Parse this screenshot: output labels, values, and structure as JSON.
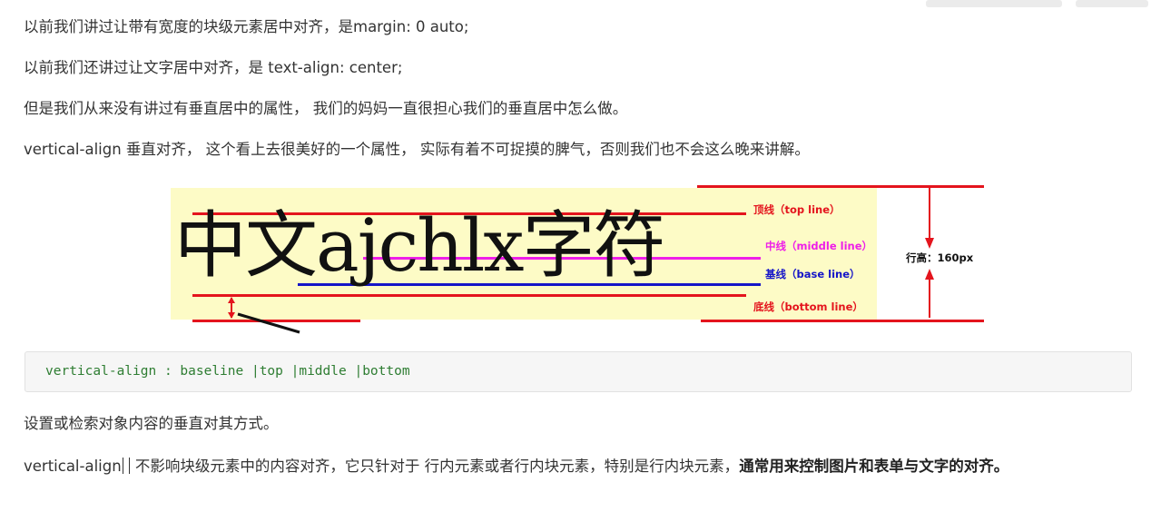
{
  "paragraphs": {
    "p1": "以前我们讲过让带有宽度的块级元素居中对齐，是margin: 0 auto;",
    "p2": "以前我们还讲过让文字居中对齐，是 text-align: center;",
    "p3": "但是我们从来没有讲过有垂直居中的属性， 我们的妈妈一直很担心我们的垂直居中怎么做。",
    "p4": "vertical-align 垂直对齐， 这个看上去很美好的一个属性， 实际有着不可捉摸的脾气，否则我们也不会这么晚来讲解。",
    "p5": "设置或检索对象内容的垂直对其方式。",
    "p6_a": "vertical-align",
    "p6_b": " 不影响块级元素中的内容对齐，它只针对于 行内元素或者行内块元素，特别是行内块元素，",
    "p6_bold": "通常用来控制图片和表单与文字的对齐。"
  },
  "figure": {
    "sample_text": "中文ajchlx字符",
    "labels": {
      "top": "顶线（top line）",
      "middle": "中线（middle line）",
      "base": "基线（base line）",
      "bottom": "底线（bottom line）",
      "line_height": "行高：160px"
    },
    "colors": {
      "red": "#e4141d",
      "blue": "#1515c8",
      "magenta": "#ee1ee8",
      "yellow": "#fdfbc6"
    }
  },
  "code": {
    "text": "vertical-align : baseline |top |middle |bottom"
  }
}
